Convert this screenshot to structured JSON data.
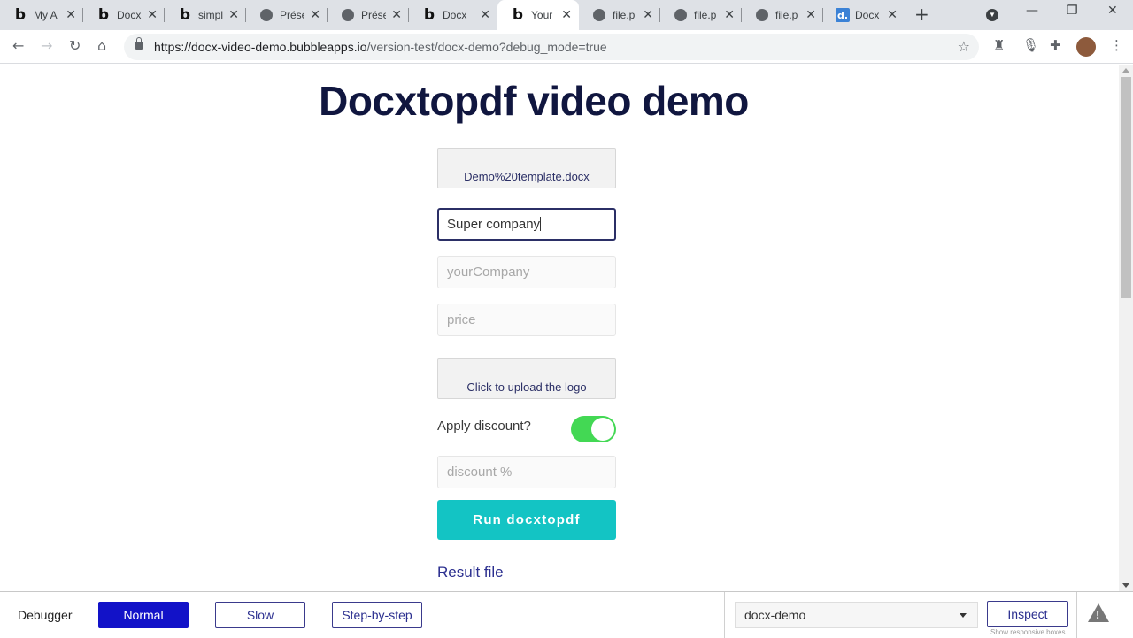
{
  "browser": {
    "tabs": [
      {
        "icon": "b",
        "title": "My A",
        "kind": "bubble"
      },
      {
        "icon": "b",
        "title": "Docx",
        "kind": "bubble"
      },
      {
        "icon": "b",
        "title": "simpl",
        "kind": "bubble"
      },
      {
        "icon": "",
        "title": "Prése",
        "kind": "globe"
      },
      {
        "icon": "",
        "title": "Prése",
        "kind": "globe"
      },
      {
        "icon": "b",
        "title": "Docx",
        "kind": "bubble"
      },
      {
        "icon": "b",
        "title": "Your",
        "kind": "bubble",
        "active": true
      },
      {
        "icon": "",
        "title": "file.p",
        "kind": "globe"
      },
      {
        "icon": "",
        "title": "file.p",
        "kind": "globe"
      },
      {
        "icon": "",
        "title": "file.p",
        "kind": "globe"
      },
      {
        "icon": "d.",
        "title": "Docx",
        "kind": "docx"
      }
    ],
    "url_host": "https://docx-video-demo.bubbleapps.io",
    "url_path": "/version-test/docx-demo?debug_mode=true"
  },
  "page": {
    "title": "Docxtopdf video demo",
    "template_file": "Demo%20template.docx",
    "client_name_value": "Super company",
    "company_placeholder": "yourCompany",
    "price_placeholder": "price",
    "logo_upload_label": "Click to upload the logo",
    "discount_label": "Apply discount?",
    "discount_enabled": true,
    "discount_placeholder": "discount %",
    "run_button": "Run docxtopdf",
    "result_link": "Result file"
  },
  "debugger": {
    "label": "Debugger",
    "modes": [
      "Normal",
      "Slow",
      "Step-by-step"
    ],
    "active_mode": "Normal",
    "page_selected": "docx-demo",
    "inspect": "Inspect",
    "responsive_hint": "Show responsive boxes"
  },
  "colors": {
    "title": "#10163f",
    "accent": "#13c4c4",
    "toggle_on": "#43d854",
    "debug_active": "#1212c8"
  }
}
